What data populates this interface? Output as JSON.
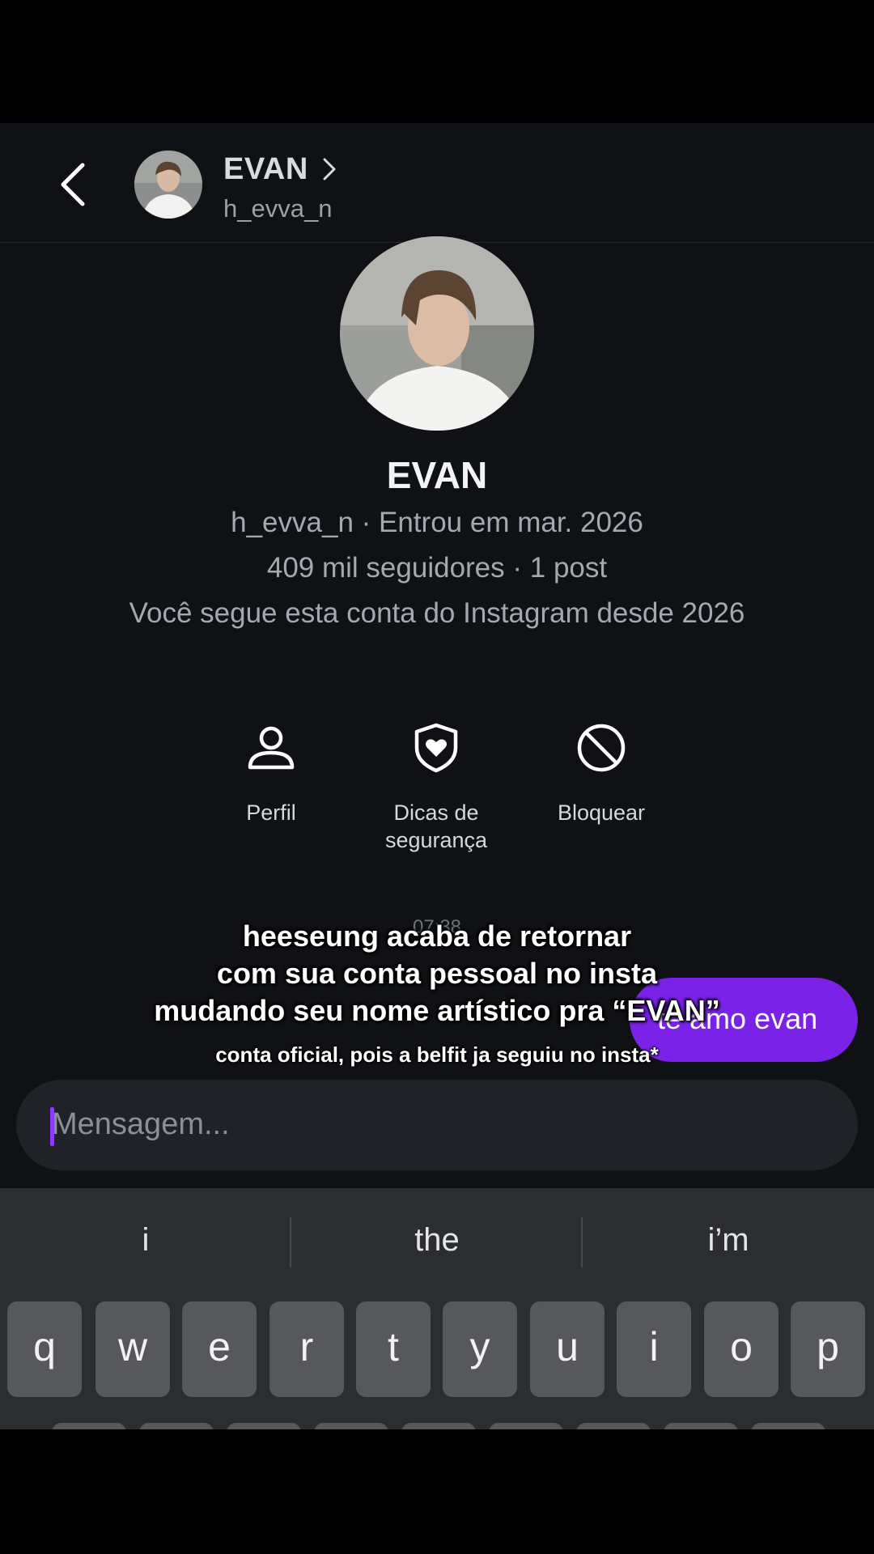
{
  "header": {
    "name": "EVAN",
    "username": "h_evva_n"
  },
  "profile": {
    "name": "EVAN",
    "line1": "h_evva_n · Entrou em mar. 2026",
    "line2": "409 mil seguidores · 1 post",
    "line3": "Você segue esta conta do Instagram desde 2026"
  },
  "actions": [
    {
      "label": "Perfil",
      "icon": "person-icon"
    },
    {
      "label": "Dicas de segurança",
      "icon": "shield-heart-icon"
    },
    {
      "label": "Bloquear",
      "icon": "block-icon"
    }
  ],
  "chat": {
    "timestamp": "07:38",
    "message": "te amo evan"
  },
  "overlay": {
    "line1": "heeseung acaba de retornar",
    "line2": "com sua conta pessoal no insta",
    "line3": "mudando seu nome artístico pra “EVAN”",
    "subline": "conta oficial, pois a belfit ja seguiu no insta*"
  },
  "composer": {
    "placeholder": "Mensagem..."
  },
  "keyboard": {
    "suggestions": [
      "i",
      "the",
      "i’m"
    ],
    "row1": [
      "q",
      "w",
      "e",
      "r",
      "t",
      "y",
      "u",
      "i",
      "o",
      "p"
    ]
  },
  "colors": {
    "accent": "#7a22e8",
    "background": "#0f1114"
  }
}
